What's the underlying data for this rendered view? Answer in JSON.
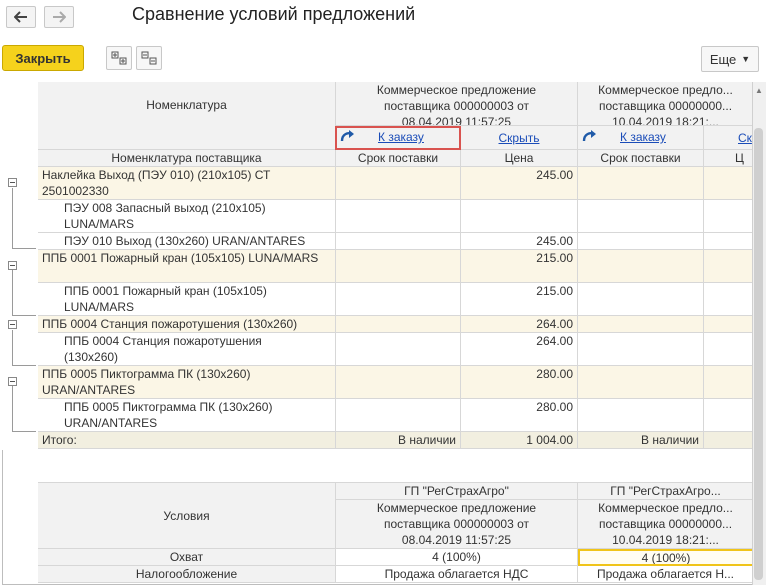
{
  "window": {
    "title": "Сравнение условий предложений"
  },
  "toolbar": {
    "close_label": "Закрыть",
    "more_label": "Еще"
  },
  "table1": {
    "col_nomenclature": "Номенклатура",
    "offer1": {
      "line1": "Коммерческое предложение",
      "line2": "поставщика 000000003 от",
      "line3": "08.04.2019 11:57:25"
    },
    "offer2": {
      "line1": "Коммерческое предло...",
      "line2": "поставщика 00000000...",
      "line3": "10.04.2019 18:21:..."
    },
    "to_order": "К заказу",
    "hide": "Скрыть",
    "hide_cut": "Ск",
    "sub_supplier_nom": "Номенклатура поставщика",
    "sub_delivery": "Срок поставки",
    "sub_price": "Цена",
    "sub_price_cut": "Ц",
    "rows": [
      {
        "name": "Наклейка Выход (ПЭУ 010) (210x105) СТ 2501002330",
        "price": "245.00"
      },
      {
        "name": "ПЭУ 008 Запасный выход (210x105) LUNA/MARS",
        "price": ""
      },
      {
        "name": "ПЭУ 010 Выход (130x260) URAN/ANTARES",
        "price": "245.00"
      },
      {
        "name": "ППБ 0001 Пожарный кран (105x105) LUNA/MARS",
        "price": "215.00"
      },
      {
        "name": "ППБ 0001 Пожарный кран (105x105) LUNA/MARS",
        "price": "215.00"
      },
      {
        "name": "ППБ 0004 Станция пожаротушения (130x260)",
        "price": "264.00"
      },
      {
        "name": "ППБ 0004 Станция пожаротушения (130x260)",
        "price": "264.00"
      },
      {
        "name": "ППБ 0005 Пиктограмма ПК (130x260) URAN/ANTARES",
        "price": "280.00"
      },
      {
        "name": "ППБ 0005 Пиктограмма ПК (130x260) URAN/ANTARES",
        "price": "280.00"
      }
    ],
    "total_label": "Итого:",
    "total_availability": "В наличии",
    "total_price": "1 004.00",
    "total_availability2": "В наличии"
  },
  "table2": {
    "col_conditions": "Условия",
    "supplier1": "ГП \"РегСтрахАгро\"",
    "supplier2": "ГП \"РегСтрахАгро...",
    "offer1": {
      "line1": "Коммерческое предложение",
      "line2": "поставщика 000000003 от",
      "line3": "08.04.2019 11:57:25"
    },
    "offer2": {
      "line1": "Коммерческое предло...",
      "line2": "поставщика 00000000...",
      "line3": "10.04.2019 18:21:..."
    },
    "coverage_label": "Охват",
    "coverage1": "4 (100%)",
    "coverage2": "4 (100%)",
    "tax_label": "Налогообложение",
    "tax1": "Продажа облагается НДС",
    "tax2": "Продажа облагается Н..."
  }
}
